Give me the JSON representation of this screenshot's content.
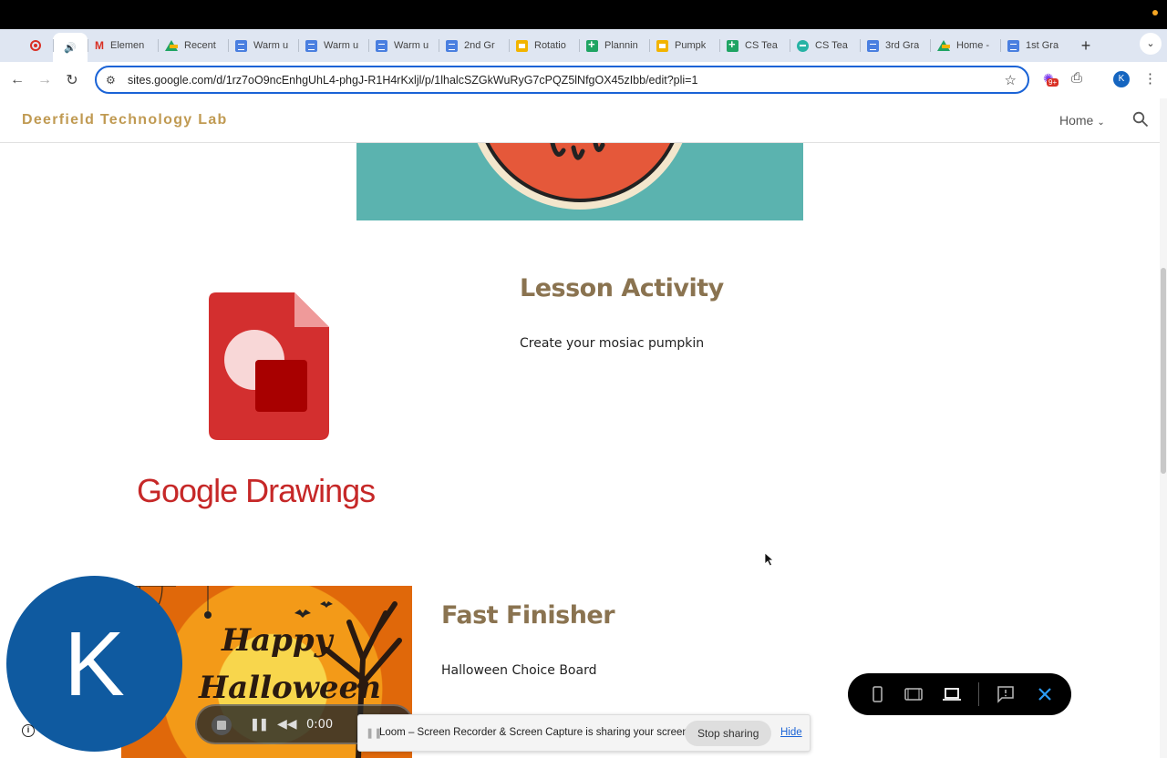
{
  "browser": {
    "tabs": [
      {
        "label": "",
        "icon": "record-icon"
      },
      {
        "label": "",
        "icon": "speaker-icon"
      },
      {
        "label": "Elemen",
        "icon": "gmail-icon"
      },
      {
        "label": "Recent",
        "icon": "google-drive-icon"
      },
      {
        "label": "Warm u",
        "icon": "google-docs-icon"
      },
      {
        "label": "Warm u",
        "icon": "google-docs-icon"
      },
      {
        "label": "Warm u",
        "icon": "google-docs-icon"
      },
      {
        "label": "2nd Gr",
        "icon": "google-docs-icon"
      },
      {
        "label": "Rotatio",
        "icon": "google-slides-icon"
      },
      {
        "label": "Plannin",
        "icon": "google-sheets-icon"
      },
      {
        "label": "Pumpk",
        "icon": "google-slides-icon"
      },
      {
        "label": "CS Tea",
        "icon": "google-sheets-icon"
      },
      {
        "label": "CS Tea",
        "icon": "google-sites-icon"
      },
      {
        "label": "3rd Gra",
        "icon": "google-docs-icon"
      },
      {
        "label": "Home -",
        "icon": "google-drive-icon"
      },
      {
        "label": "1st Gra",
        "icon": "google-docs-icon"
      }
    ],
    "new_tab": "+",
    "url": "sites.google.com/d/1rz7oO9ncEnhgUhL4-phgJ-R1H4rKxljl/p/1lhalcSZGkWuRyG7cPQZ5lNfgOX45zIbb/edit?pli=1",
    "extension_badge": "9+",
    "profile_initial": "K"
  },
  "site": {
    "title": "Deerfield Technology Lab",
    "nav_home": "Home"
  },
  "lesson": {
    "heading": "Lesson Activity",
    "text": "Create your mosiac pumpkin",
    "logo_word": "Google Drawings"
  },
  "finisher": {
    "heading": "Fast Finisher",
    "text": "Halloween Choice Board",
    "image_text_1": "Happy",
    "image_text_2": "Halloween"
  },
  "recorder": {
    "camera_initial": "K",
    "time": "0:00",
    "share_message": "Loom – Screen Recorder & Screen Capture is sharing your screen.",
    "stop_label": "Stop sharing",
    "hide_label": "Hide"
  },
  "colors": {
    "accent": "#c09a52",
    "heading": "#8a7350",
    "teal": "#5bb3af",
    "drawings_red": "#c62828",
    "loom_blue": "#0f5aa0"
  }
}
